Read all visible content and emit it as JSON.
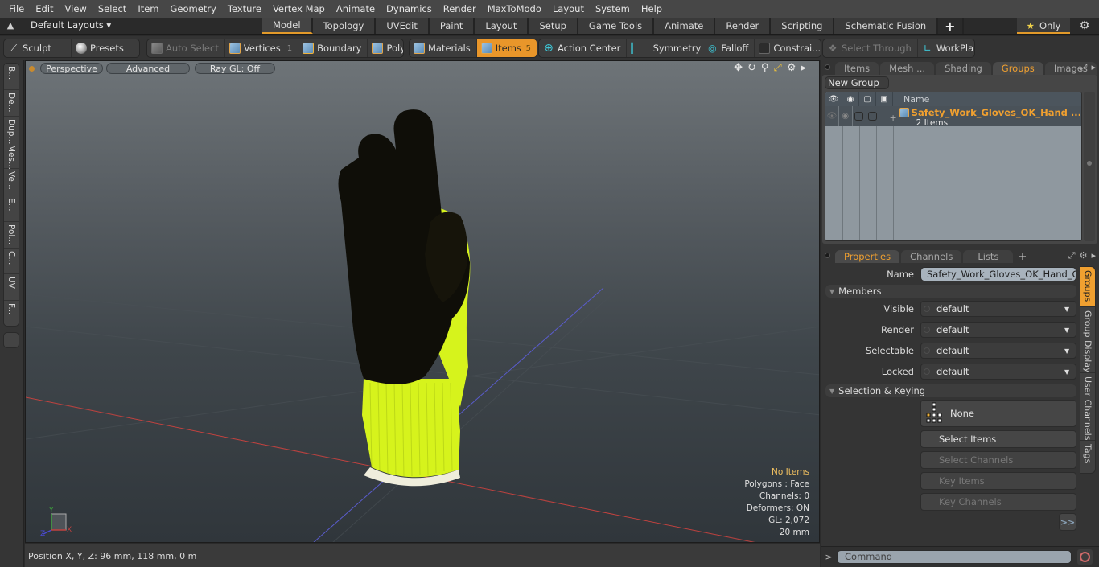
{
  "menubar": {
    "items": [
      "File",
      "Edit",
      "View",
      "Select",
      "Item",
      "Geometry",
      "Texture",
      "Vertex Map",
      "Animate",
      "Dynamics",
      "Render",
      "MaxToModo",
      "Layout",
      "System",
      "Help"
    ]
  },
  "layoutbar": {
    "layout_select": "Default Layouts ▾",
    "mode_tabs": [
      {
        "label": "Model",
        "active": true
      },
      {
        "label": "Topology"
      },
      {
        "label": "UVEdit"
      },
      {
        "label": "Paint"
      },
      {
        "label": "Layout"
      },
      {
        "label": "Setup"
      },
      {
        "label": "Game Tools"
      },
      {
        "label": "Animate"
      },
      {
        "label": "Render"
      },
      {
        "label": "Scripting"
      },
      {
        "label": "Schematic Fusion"
      }
    ],
    "add_tab": "+",
    "only_label": "Only"
  },
  "toolbar": {
    "sculpt": "Sculpt",
    "presets": "Presets",
    "auto_select": "Auto Select",
    "vertices": "Vertices",
    "vertices_count": "1",
    "boundary": "Boundary",
    "polygons": "Polygons",
    "materials": "Materials",
    "items": "Items",
    "items_count": "5",
    "action_center": "Action Center",
    "symmetry": "Symmetry",
    "falloff": "Falloff",
    "constraints": "Constrai...",
    "select_through": "Select Through",
    "workplane": "WorkPlane"
  },
  "left_tabs": [
    "B...",
    "De...",
    "Dup...",
    "Mes...",
    "Ve...",
    "E...",
    "Pol...",
    "C...",
    "UV",
    "F..."
  ],
  "viewport": {
    "view_mode": "Perspective",
    "shading": "Advanced",
    "raygl": "Ray GL: Off",
    "info": {
      "selection": "No Items",
      "polygons": "Polygons : Face",
      "channels": "Channels: 0",
      "deformers": "Deformers: ON",
      "gl": "GL: 2,072",
      "grid": "20 mm"
    },
    "axis_labels": {
      "x": "X",
      "y": "Y",
      "z": "Z"
    },
    "colors": {
      "glove_yellow": "#d8f51e",
      "glove_black": "#0f0e08",
      "cuff_white": "#f0eedd",
      "x_axis": "#c0423f",
      "z_axis": "#5a5ccc"
    }
  },
  "statusbar": {
    "position": "Position X, Y, Z:   96 mm, 118 mm, 0 m"
  },
  "groups_panel": {
    "tabs": [
      {
        "label": "Items"
      },
      {
        "label": "Mesh ..."
      },
      {
        "label": "Shading"
      },
      {
        "label": "Groups",
        "active": true
      },
      {
        "label": "Images"
      }
    ],
    "new_group": "New Group",
    "column_name": "Name",
    "rows": [
      {
        "name": "Safety_Work_Gloves_OK_Hand ...",
        "sub": "2 Items",
        "expand": "+"
      }
    ]
  },
  "properties_panel": {
    "tabs": [
      {
        "label": "Properties",
        "active": true
      },
      {
        "label": "Channels"
      },
      {
        "label": "Lists"
      }
    ],
    "name_label": "Name",
    "name_value": "Safety_Work_Gloves_OK_Hand_Gesture",
    "members_section": "Members",
    "fields": [
      {
        "label": "Visible",
        "value": "default"
      },
      {
        "label": "Render",
        "value": "default"
      },
      {
        "label": "Selectable",
        "value": "default"
      },
      {
        "label": "Locked",
        "value": "default"
      }
    ],
    "selection_section": "Selection & Keying",
    "none_button": "None",
    "select_items": "Select Items",
    "select_channels": "Select Channels",
    "key_items": "Key Items",
    "key_channels": "Key Channels",
    "more": ">>",
    "side_tabs": [
      {
        "label": "Groups",
        "active": true
      },
      {
        "label": "Group Display"
      },
      {
        "label": "User Channels"
      },
      {
        "label": "Tags"
      }
    ]
  },
  "command": {
    "prompt": ">",
    "placeholder": "Command"
  },
  "accent_color": "#e9962a"
}
